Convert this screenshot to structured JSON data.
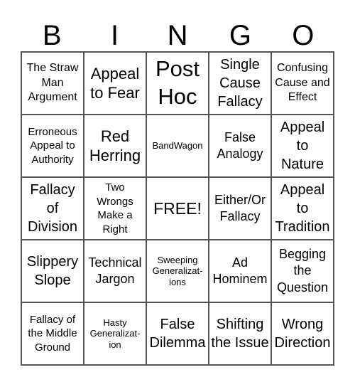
{
  "header": {
    "letters": [
      "B",
      "I",
      "N",
      "G",
      "O"
    ]
  },
  "cells": [
    "The Straw Man Argument",
    "Appeal to Fear",
    "Post Hoc",
    "Single Cause Fallacy",
    "Confusing Cause and Effect",
    "Erroneous Appeal to Authority",
    "Red Herring",
    "BandWagon",
    "False Analogy",
    "Appeal to Nature",
    "Fallacy of Division",
    "Two Wrongs Make a Right",
    "FREE!",
    "Either/Or Fallacy",
    "Appeal to Tradition",
    "Slippery Slope",
    "Technical Jargon",
    "Sweeping Generalizat-ions",
    "Ad Hominem",
    "Begging the Question",
    "Fallacy of the Middle Ground",
    "Hasty Generalizat-ion",
    "False Dilemma",
    "Shifting the Issue",
    "Wrong Direction"
  ]
}
